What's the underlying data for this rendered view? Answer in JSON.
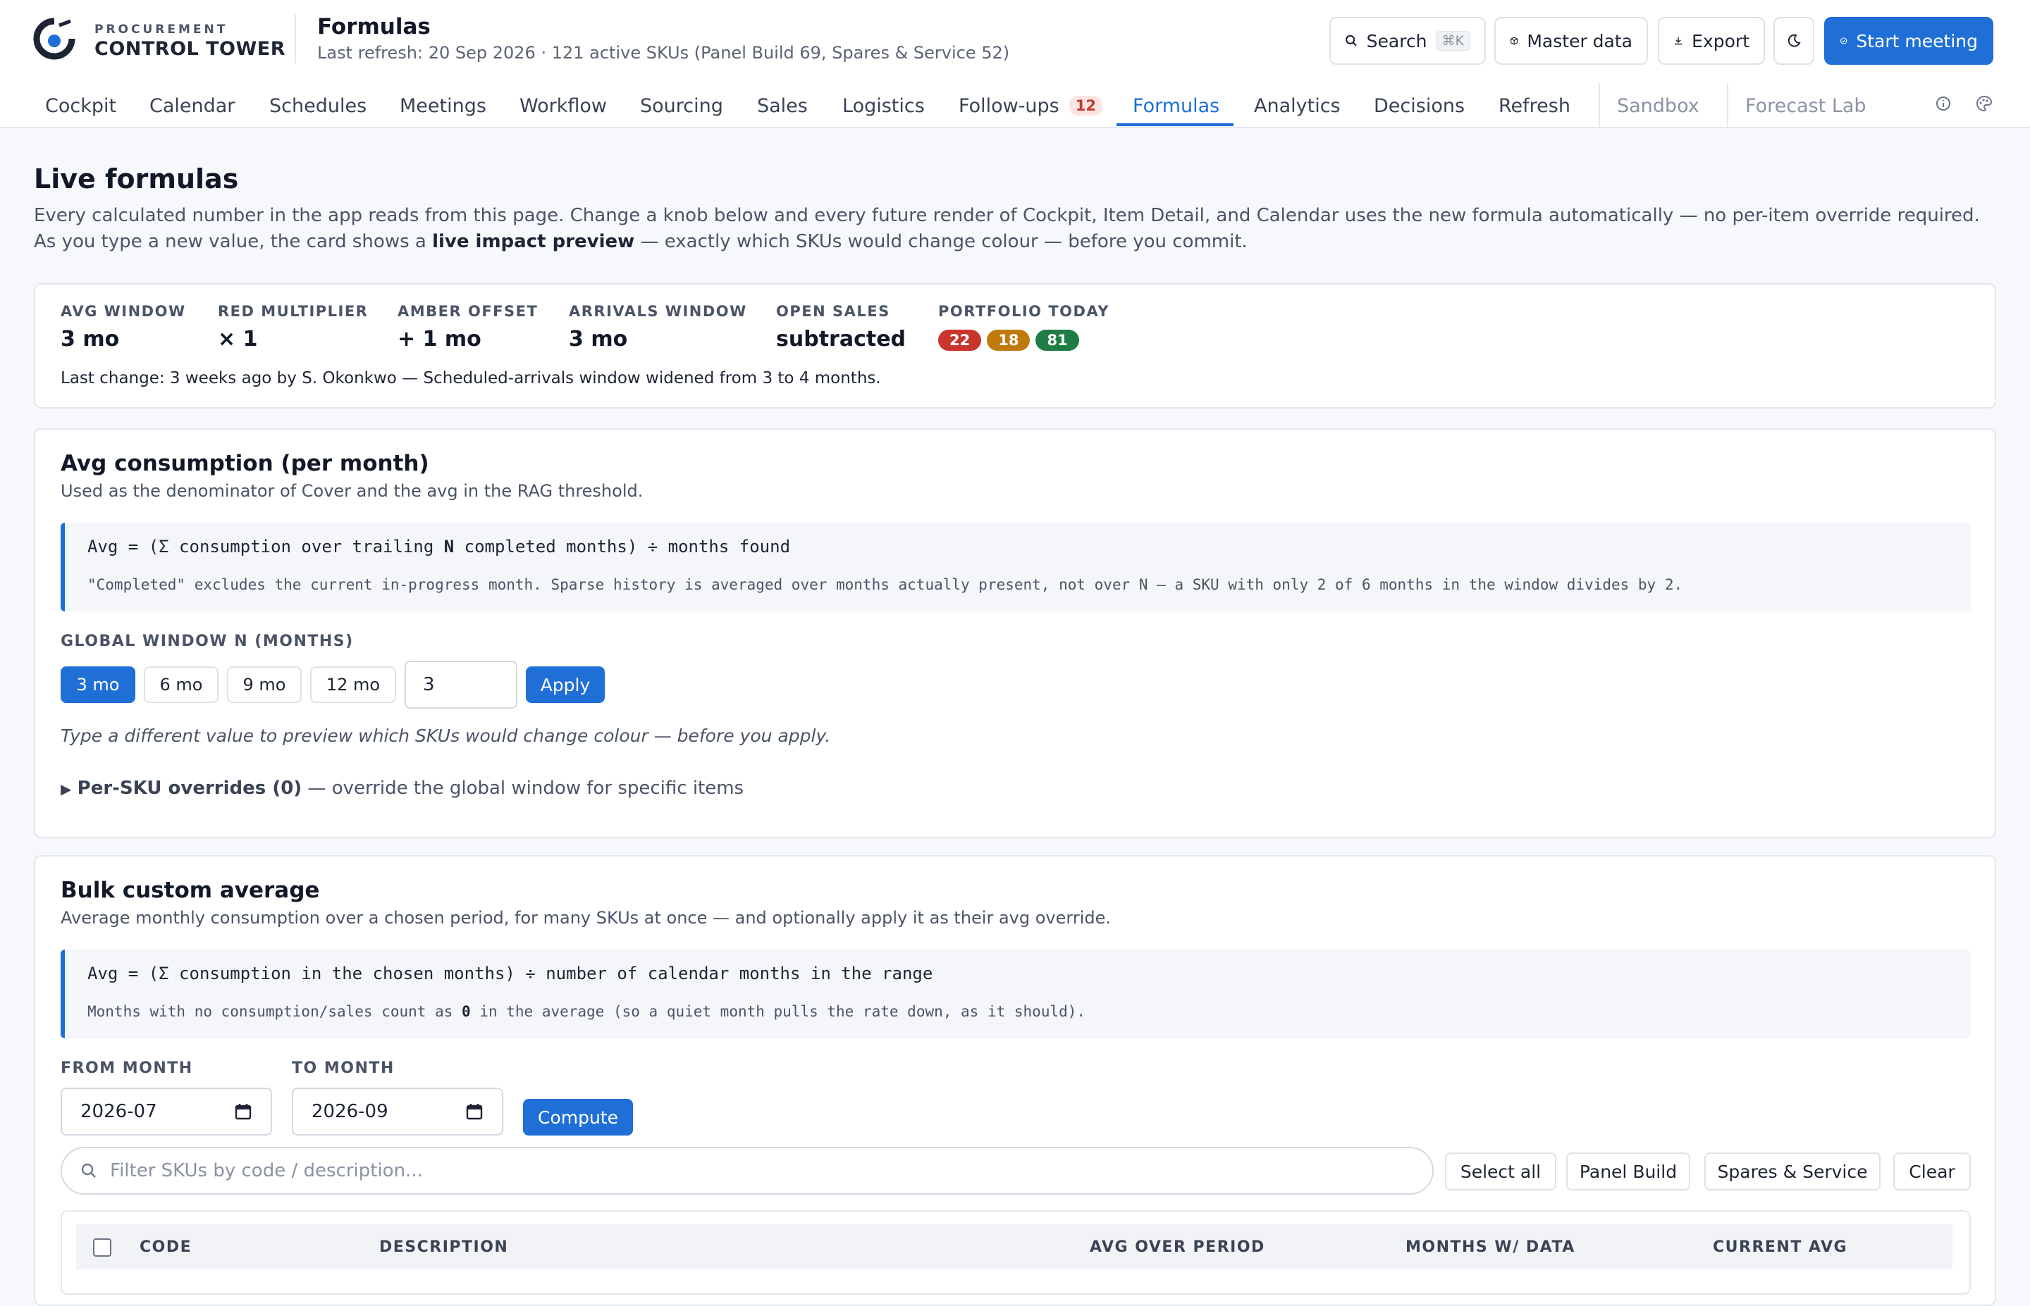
{
  "brand": {
    "top": "PROCUREMENT",
    "main": "CONTROL TOWER"
  },
  "header": {
    "title": "Formulas",
    "subtitle": "Last refresh: 20 Sep 2026 · 121 active SKUs (Panel Build 69, Spares & Service 52)"
  },
  "actions": {
    "search": "Search",
    "search_kbd": "⌘K",
    "master": "Master data",
    "export": "Export",
    "start": "Start meeting"
  },
  "nav": {
    "items": [
      "Cockpit",
      "Calendar",
      "Schedules",
      "Meetings",
      "Workflow",
      "Sourcing",
      "Sales",
      "Logistics",
      "Follow-ups",
      "Formulas",
      "Analytics",
      "Decisions",
      "Refresh"
    ],
    "followups_count": "12",
    "active": "Formulas",
    "extra": [
      "Sandbox",
      "Forecast Lab"
    ]
  },
  "main": {
    "title": "Live formulas",
    "intro_1": "Every calculated number in the app reads from this page. Change a knob below and every future render of Cockpit, Item Detail, and Calendar uses the new formula automatically — no per-item override required.",
    "intro_2a": "As you type a new value, the card shows a ",
    "intro_2b": "live impact preview",
    "intro_2c": " — exactly which SKUs would change colour — before you commit."
  },
  "summary": {
    "stats": [
      {
        "label": "AVG WINDOW",
        "value": "3 mo"
      },
      {
        "label": "RED MULTIPLIER",
        "value": "× 1"
      },
      {
        "label": "AMBER OFFSET",
        "value": "+ 1 mo"
      },
      {
        "label": "ARRIVALS WINDOW",
        "value": "3 mo"
      },
      {
        "label": "OPEN SALES",
        "value": "subtracted"
      }
    ],
    "portfolio_label": "PORTFOLIO TODAY",
    "portfolio": {
      "red": "22",
      "amber": "18",
      "green": "81"
    },
    "last_change": "Last change: 3 weeks ago by S. Okonkwo — Scheduled-arrivals window widened from 3 to 4 months."
  },
  "avg": {
    "title": "Avg consumption (per month)",
    "subtitle": "Used as the denominator of Cover and the avg in the RAG threshold.",
    "formula_a": "Avg = (Σ consumption over trailing ",
    "formula_n": "N",
    "formula_b": " completed months) ÷ months found",
    "note": "\"Completed\" excludes the current in-progress month. Sparse history is averaged over months actually present, not over N — a SKU with only 2 of 6 months in the window divides by 2.",
    "window_label": "GLOBAL WINDOW N (MONTHS)",
    "chips": [
      "3 mo",
      "6 mo",
      "9 mo",
      "12 mo"
    ],
    "input_value": "3",
    "apply": "Apply",
    "hint": "Type a different value to preview which SKUs would change colour — before you apply.",
    "overrides_toggle": "▶",
    "overrides_bold": "Per-SKU overrides (0)",
    "overrides_rest": " — override the global window for specific items"
  },
  "bulk": {
    "title": "Bulk custom average",
    "subtitle": "Average monthly consumption over a chosen period, for many SKUs at once — and optionally apply it as their avg override.",
    "formula": "Avg = (Σ consumption in the chosen months) ÷ number of calendar months in the range",
    "note_a": "Months with no consumption/sales count as ",
    "note_b": "0",
    "note_c": " in the average (so a quiet month pulls the rate down, as it should).",
    "from_label": "FROM MONTH",
    "from_value": "2026-07",
    "to_label": "TO MONTH",
    "to_value": "2026-09",
    "compute": "Compute",
    "search_placeholder": "Filter SKUs by code / description...",
    "buttons": [
      "Select all",
      "Panel Build",
      "Spares & Service",
      "Clear"
    ],
    "columns": [
      "CODE",
      "DESCRIPTION",
      "AVG OVER PERIOD",
      "MONTHS W/ DATA",
      "CURRENT AVG"
    ]
  },
  "colors": {
    "accent": "#1f6fd6",
    "red": "#c9342c",
    "amber": "#c07a0c",
    "green": "#1e7d45"
  }
}
